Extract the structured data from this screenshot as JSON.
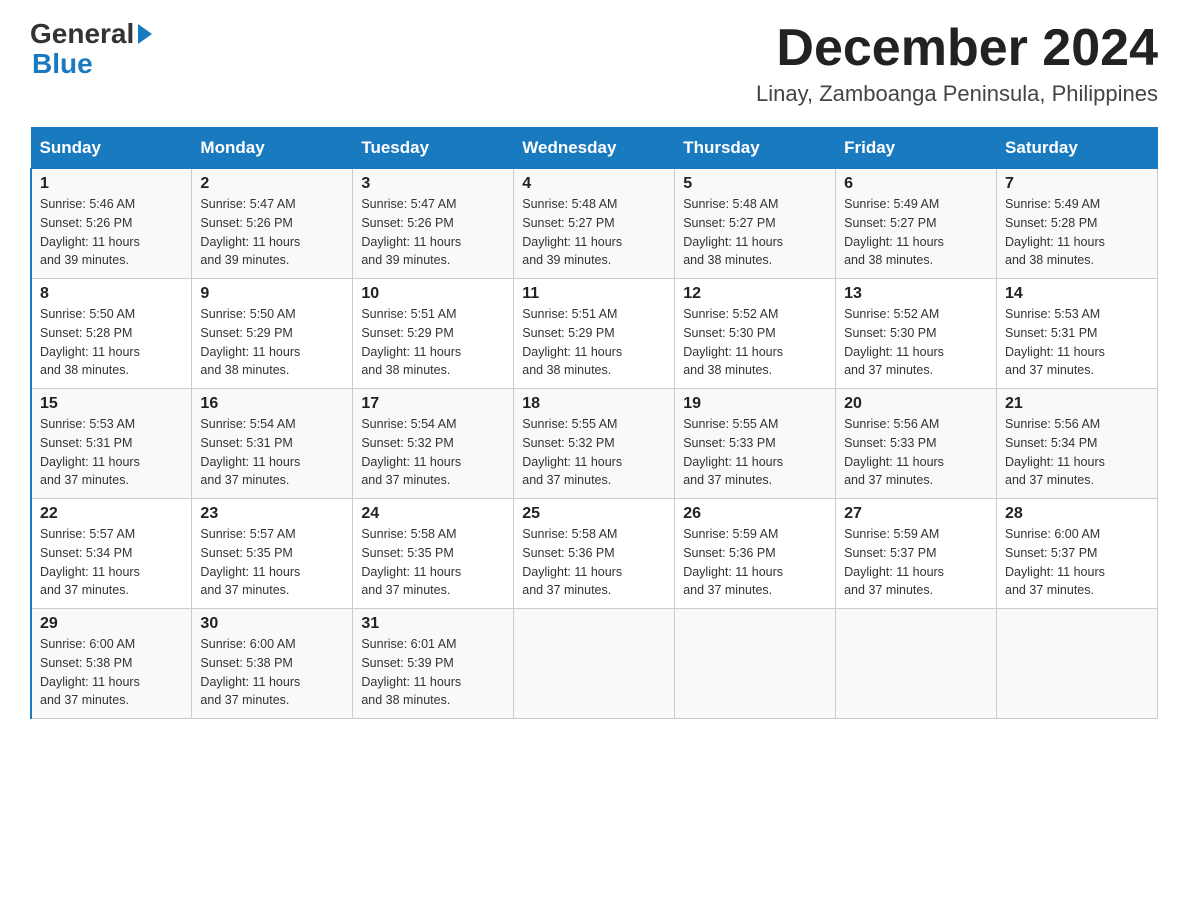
{
  "logo": {
    "general": "General",
    "blue": "Blue"
  },
  "title": "December 2024",
  "location": "Linay, Zamboanga Peninsula, Philippines",
  "days_of_week": [
    "Sunday",
    "Monday",
    "Tuesday",
    "Wednesday",
    "Thursday",
    "Friday",
    "Saturday"
  ],
  "weeks": [
    [
      {
        "day": "1",
        "sunrise": "5:46 AM",
        "sunset": "5:26 PM",
        "daylight": "11 hours and 39 minutes."
      },
      {
        "day": "2",
        "sunrise": "5:47 AM",
        "sunset": "5:26 PM",
        "daylight": "11 hours and 39 minutes."
      },
      {
        "day": "3",
        "sunrise": "5:47 AM",
        "sunset": "5:26 PM",
        "daylight": "11 hours and 39 minutes."
      },
      {
        "day": "4",
        "sunrise": "5:48 AM",
        "sunset": "5:27 PM",
        "daylight": "11 hours and 39 minutes."
      },
      {
        "day": "5",
        "sunrise": "5:48 AM",
        "sunset": "5:27 PM",
        "daylight": "11 hours and 38 minutes."
      },
      {
        "day": "6",
        "sunrise": "5:49 AM",
        "sunset": "5:27 PM",
        "daylight": "11 hours and 38 minutes."
      },
      {
        "day": "7",
        "sunrise": "5:49 AM",
        "sunset": "5:28 PM",
        "daylight": "11 hours and 38 minutes."
      }
    ],
    [
      {
        "day": "8",
        "sunrise": "5:50 AM",
        "sunset": "5:28 PM",
        "daylight": "11 hours and 38 minutes."
      },
      {
        "day": "9",
        "sunrise": "5:50 AM",
        "sunset": "5:29 PM",
        "daylight": "11 hours and 38 minutes."
      },
      {
        "day": "10",
        "sunrise": "5:51 AM",
        "sunset": "5:29 PM",
        "daylight": "11 hours and 38 minutes."
      },
      {
        "day": "11",
        "sunrise": "5:51 AM",
        "sunset": "5:29 PM",
        "daylight": "11 hours and 38 minutes."
      },
      {
        "day": "12",
        "sunrise": "5:52 AM",
        "sunset": "5:30 PM",
        "daylight": "11 hours and 38 minutes."
      },
      {
        "day": "13",
        "sunrise": "5:52 AM",
        "sunset": "5:30 PM",
        "daylight": "11 hours and 37 minutes."
      },
      {
        "day": "14",
        "sunrise": "5:53 AM",
        "sunset": "5:31 PM",
        "daylight": "11 hours and 37 minutes."
      }
    ],
    [
      {
        "day": "15",
        "sunrise": "5:53 AM",
        "sunset": "5:31 PM",
        "daylight": "11 hours and 37 minutes."
      },
      {
        "day": "16",
        "sunrise": "5:54 AM",
        "sunset": "5:31 PM",
        "daylight": "11 hours and 37 minutes."
      },
      {
        "day": "17",
        "sunrise": "5:54 AM",
        "sunset": "5:32 PM",
        "daylight": "11 hours and 37 minutes."
      },
      {
        "day": "18",
        "sunrise": "5:55 AM",
        "sunset": "5:32 PM",
        "daylight": "11 hours and 37 minutes."
      },
      {
        "day": "19",
        "sunrise": "5:55 AM",
        "sunset": "5:33 PM",
        "daylight": "11 hours and 37 minutes."
      },
      {
        "day": "20",
        "sunrise": "5:56 AM",
        "sunset": "5:33 PM",
        "daylight": "11 hours and 37 minutes."
      },
      {
        "day": "21",
        "sunrise": "5:56 AM",
        "sunset": "5:34 PM",
        "daylight": "11 hours and 37 minutes."
      }
    ],
    [
      {
        "day": "22",
        "sunrise": "5:57 AM",
        "sunset": "5:34 PM",
        "daylight": "11 hours and 37 minutes."
      },
      {
        "day": "23",
        "sunrise": "5:57 AM",
        "sunset": "5:35 PM",
        "daylight": "11 hours and 37 minutes."
      },
      {
        "day": "24",
        "sunrise": "5:58 AM",
        "sunset": "5:35 PM",
        "daylight": "11 hours and 37 minutes."
      },
      {
        "day": "25",
        "sunrise": "5:58 AM",
        "sunset": "5:36 PM",
        "daylight": "11 hours and 37 minutes."
      },
      {
        "day": "26",
        "sunrise": "5:59 AM",
        "sunset": "5:36 PM",
        "daylight": "11 hours and 37 minutes."
      },
      {
        "day": "27",
        "sunrise": "5:59 AM",
        "sunset": "5:37 PM",
        "daylight": "11 hours and 37 minutes."
      },
      {
        "day": "28",
        "sunrise": "6:00 AM",
        "sunset": "5:37 PM",
        "daylight": "11 hours and 37 minutes."
      }
    ],
    [
      {
        "day": "29",
        "sunrise": "6:00 AM",
        "sunset": "5:38 PM",
        "daylight": "11 hours and 37 minutes."
      },
      {
        "day": "30",
        "sunrise": "6:00 AM",
        "sunset": "5:38 PM",
        "daylight": "11 hours and 37 minutes."
      },
      {
        "day": "31",
        "sunrise": "6:01 AM",
        "sunset": "5:39 PM",
        "daylight": "11 hours and 38 minutes."
      },
      null,
      null,
      null,
      null
    ]
  ],
  "labels": {
    "sunrise": "Sunrise:",
    "sunset": "Sunset:",
    "daylight": "Daylight:"
  }
}
